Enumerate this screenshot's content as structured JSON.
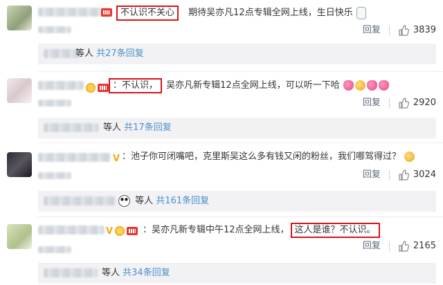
{
  "comments": [
    {
      "text_before": "",
      "highlight": "不认识不关心",
      "text_after": "期待吴亦凡12点专辑全网上线，生日快乐",
      "reply_label": "回复",
      "likes": "3839",
      "thread": {
        "others": "等人",
        "count": "共27条回复"
      }
    },
    {
      "text_before": "",
      "highlight": "：不认识，",
      "text_after": "吴亦凡新专辑12点全网上线，可以听一下哈",
      "reply_label": "回复",
      "likes": "2920",
      "thread": {
        "others": "等人",
        "count": "共17条回复"
      }
    },
    {
      "text_before": "：池子你可闭嘴吧，克里斯吴这么多有钱又闲的粉丝，我们哪驾得过？",
      "highlight": "",
      "text_after": "",
      "reply_label": "回复",
      "likes": "3024",
      "thread": {
        "others": "等人",
        "count": "共161条回复"
      }
    },
    {
      "text_before": "：吴亦凡新专辑中午12点全网上线，",
      "highlight": "这人是谁？不认识。",
      "text_after": "",
      "reply_label": "回复",
      "likes": "2165",
      "thread": {
        "others": "等人",
        "count": "共34条回复"
      }
    }
  ],
  "colors": {
    "highlight_border": "#d8131a",
    "reply_count_link": "#4a8fc9",
    "verified_badge": "#f4a81c"
  },
  "icons": {
    "like": "thumbs-up-icon",
    "verified": "v-badge-icon",
    "vip": "vip-badge-icon"
  }
}
